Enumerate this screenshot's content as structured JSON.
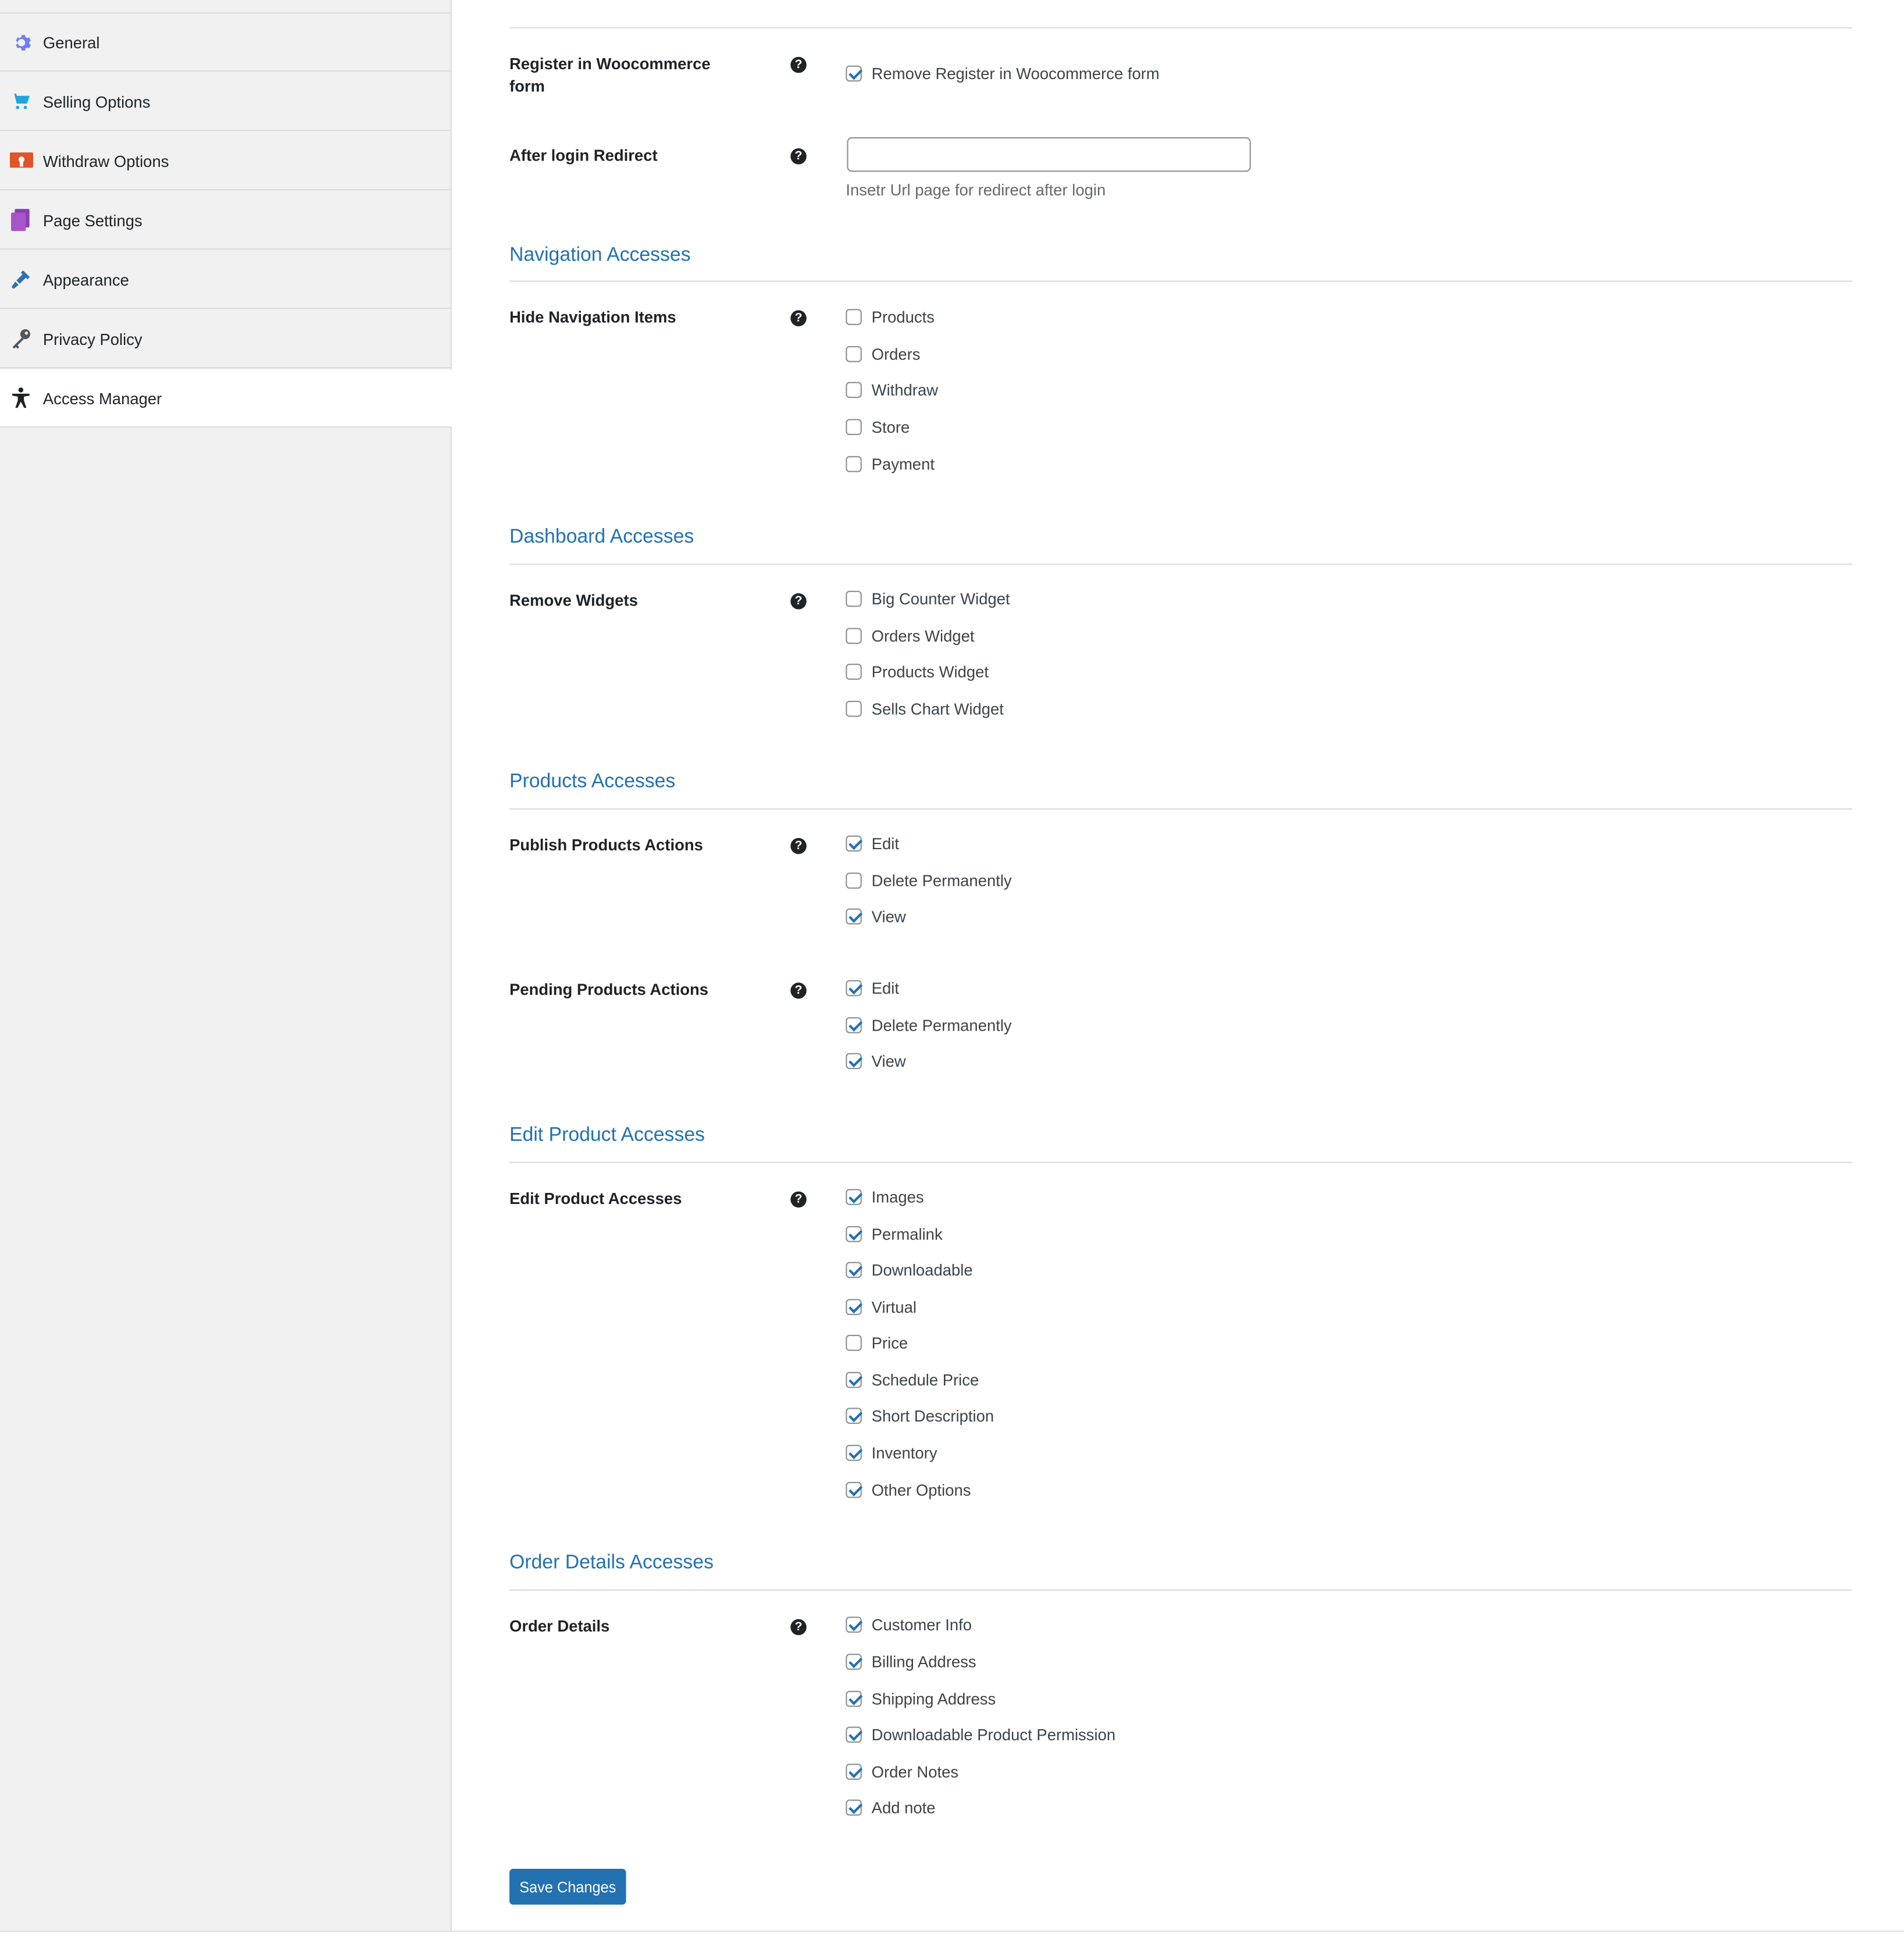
{
  "colors": {
    "accent": "#2271b1",
    "sidebar_bg": "#f1f1f1",
    "text": "#1d2327"
  },
  "sidebar": {
    "items": [
      {
        "label": "General",
        "icon": "gear-icon",
        "active": false
      },
      {
        "label": "Selling Options",
        "icon": "cart-icon",
        "active": false
      },
      {
        "label": "Withdraw Options",
        "icon": "withdraw-icon",
        "active": false
      },
      {
        "label": "Page Settings",
        "icon": "page-icon",
        "active": false
      },
      {
        "label": "Appearance",
        "icon": "brush-icon",
        "active": false
      },
      {
        "label": "Privacy Policy",
        "icon": "key-icon",
        "active": false
      },
      {
        "label": "Access Manager",
        "icon": "accessibility-icon",
        "active": true
      }
    ]
  },
  "register": {
    "label": "Register in Woocommerce form",
    "option": {
      "label": "Remove Register in Woocommerce form",
      "checked": true
    }
  },
  "redirect": {
    "label": "After login Redirect",
    "value": "",
    "description": "Insetr Url page for redirect after login"
  },
  "sections": {
    "navigation": {
      "title": "Navigation Accesses",
      "row_label": "Hide Navigation Items",
      "options": [
        {
          "label": "Products",
          "checked": false
        },
        {
          "label": "Orders",
          "checked": false
        },
        {
          "label": "Withdraw",
          "checked": false
        },
        {
          "label": "Store",
          "checked": false
        },
        {
          "label": "Payment",
          "checked": false
        }
      ]
    },
    "dashboard": {
      "title": "Dashboard Accesses",
      "row_label": "Remove Widgets",
      "options": [
        {
          "label": "Big Counter Widget",
          "checked": false
        },
        {
          "label": "Orders Widget",
          "checked": false
        },
        {
          "label": "Products Widget",
          "checked": false
        },
        {
          "label": "Sells Chart Widget",
          "checked": false
        }
      ]
    },
    "products": {
      "title": "Products Accesses",
      "publish_label": "Publish Products Actions",
      "publish_options": [
        {
          "label": "Edit",
          "checked": true
        },
        {
          "label": "Delete Permanently",
          "checked": false
        },
        {
          "label": "View",
          "checked": true
        }
      ],
      "pending_label": "Pending Products Actions",
      "pending_options": [
        {
          "label": "Edit",
          "checked": true
        },
        {
          "label": "Delete Permanently",
          "checked": true
        },
        {
          "label": "View",
          "checked": true
        }
      ]
    },
    "edit_product": {
      "title": "Edit Product Accesses",
      "row_label": "Edit Product Accesses",
      "options": [
        {
          "label": "Images",
          "checked": true
        },
        {
          "label": "Permalink",
          "checked": true
        },
        {
          "label": "Downloadable",
          "checked": true
        },
        {
          "label": "Virtual",
          "checked": true
        },
        {
          "label": "Price",
          "checked": false
        },
        {
          "label": "Schedule Price",
          "checked": true
        },
        {
          "label": "Short Description",
          "checked": true
        },
        {
          "label": "Inventory",
          "checked": true
        },
        {
          "label": "Other Options",
          "checked": true
        }
      ]
    },
    "order_details": {
      "title": "Order Details Accesses",
      "row_label": "Order Details",
      "options": [
        {
          "label": "Customer Info",
          "checked": true
        },
        {
          "label": "Billing Address",
          "checked": true
        },
        {
          "label": "Shipping Address",
          "checked": true
        },
        {
          "label": "Downloadable Product Permission",
          "checked": true
        },
        {
          "label": "Order Notes",
          "checked": true
        },
        {
          "label": "Add note",
          "checked": true
        }
      ]
    }
  },
  "help_glyph": "?",
  "save_label": "Save Changes"
}
